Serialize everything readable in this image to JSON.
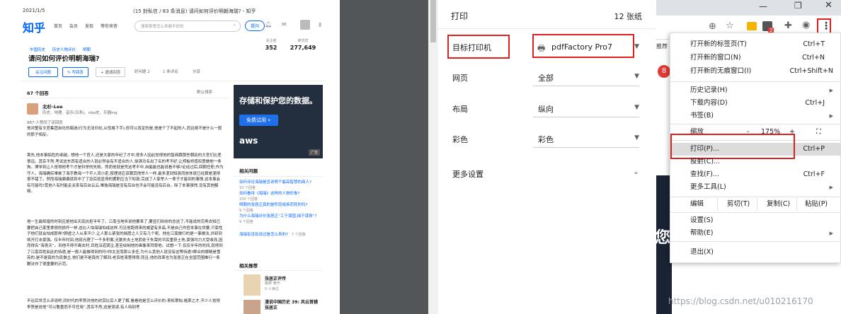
{
  "preview": {
    "date": "2021/1/5",
    "doc_title": "(15 封私信 / 83 条消息) 请问如何评价明朝海瑞? - 知乎",
    "logo": "知乎",
    "nav": [
      "首页",
      "会员",
      "发现",
      "等你来答"
    ],
    "search_placeholder": "搜索那里怎么来都不好的",
    "ask_label": "提问",
    "topics": [
      "中国历史",
      "历史人物评价",
      "明朝"
    ],
    "question": "请问如何评价明朝海瑞?",
    "followers_label": "关注者",
    "followers": "352",
    "views_label": "被浏览",
    "views": "277,649",
    "btn_follow": "关注问题",
    "btn_answer": "写回答",
    "btn_invite": "邀请回答",
    "like": "好问题 2",
    "comments": "1 条评论",
    "share": "分享",
    "answers_count": "67 个回答",
    "sort": "默认排序",
    "author_name": "北杉-Lee",
    "author_desc": "历史、地理、音乐(日系)、nba史、乐器ing",
    "agree": "987 人赞同了该回答",
    "para1": "他对整有文官集团自化的痴迷(行为无法归化,从性格下手),但可以肯定的是,他是个了不起的人,而且绝不是什么一般的那子相反。",
    "para2": "首先,他本事临危的卓越。想他一个官人,还是大家的年纪了才中,很多人因此觉得他的智商跟那些朝廷的大官们比差很远。其实不然,考试这东西有适合的人就必然会有不适合的人,徐渭功名出了名的考不好,让郑板桥感叹愿做他一条狗。博学到让人觉得他考个才是科举的失败。然而他就是凭这考不中,自能能也能说看不够?论经过后,回朝任职,作为守人。海瑞确实难挨了海手教诲一个不入流小吏,按理说应该跟其他举人一样,最多混到知县而放休就已经算是混得很不错了。然而海瑞偏偏就到中了了及后就显得的罢职应当下知县,完成了人家举人一辈子才能到的事情,这本事会有可能吗?其他人有时能走关系有后台云云,唯独海瑞是没有后台也不会可能没有后台。除了本事强悍,没有其他解释。",
    "para3": "他一生最辉煌的时刻应是他出天底抗拒半年了。江南当地听说他要来了,要显们纷纷的念这了,不能说的完再去知已要把自己家里拿很的损坏一样,这比人怕海瑞怕成这样,可见他跑得来的威望有多高,不是自己作官本事在世要,只靠性子他们就会怕成那样?顾虚之人从来不少,让人那么紧张的倘愿之人又有几个呢。他在江南做行的是一事做法,并卸到将开打击豪强。仅半年时间,他就光理了一千多积案,无数失去土地而处于失荣的平民重获土地,豪强均力大受收改,因而得名“海青天”。到他不得不离去时,百姓沿道哭泣,甚至绘制他的画像来拜祭他。试想一下,仅仅半年的时间,就得到了江南百姓如此的待遇,是一般人能做得到的吗?你太至而那么多任,为什么其他人就没有这等待遇?群众的眼睛是雪亮的,是不是真的为民做主,他们是不是真的了解到,老百姓清楚得很,而且,他的改革也为张居正在全国范围推行一条鞭法作了很重要的示范。",
    "para4": "不论后世怎么评说吧,同时代的李贽对他的欣赏比后人更了解,看看他是怎么评价的:青松翠柏,格莱之才,不少人觉得李贽是说他“可以敬重而不可任用”,其实不然,这是误读,有人特别考",
    "ad_title": "存储和保护您的数据。",
    "ad_btn": "免费试用 »",
    "ad_brand": "aws",
    "ad_tag": "广告",
    "related_title": "相关问题",
    "related": [
      {
        "q": "如何评论海瑞是否说明个最高智慧的商人?",
        "n": "10 个回答"
      },
      {
        "q": "如何看待《海瑞》这样的人物形象?",
        "n": "150 个回答"
      },
      {
        "q": "明朝的张居正真的是积怨成疾而死的吗?",
        "n": "9 个回答"
      },
      {
        "q": "为什么海瑞评价张居正“工于谋国,拙于谋身”?",
        "n": "9 个回答"
      },
      {
        "q": "海瑞有没有说过是怎么来的?",
        "n": "7 个回答"
      }
    ],
    "rec_title": "相关推荐",
    "rec1_title": "张居正评传",
    "rec1_sub": "跟野 著作",
    "rec1_cnt": "0 人读过",
    "rec2_title": "漫说中国历史 39: 风云首辅张居正"
  },
  "panel": {
    "title": "打印",
    "sheets": "12 张纸",
    "destination_label": "目标打印机",
    "destination_value": "pdfFactory Pro7",
    "pages_label": "网页",
    "pages_value": "全部",
    "layout_label": "布局",
    "layout_value": "纵向",
    "color_label": "彩色",
    "color_value": "彩色",
    "more_label": "更多设置"
  },
  "browser": {
    "badge_count": "2",
    "notif_count": "8",
    "partial_text": "推荐",
    "big_char": "您"
  },
  "menu": {
    "new_tab": "打开新的标签页(T)",
    "new_tab_sc": "Ctrl+T",
    "new_window": "打开新的窗口(N)",
    "new_window_sc": "Ctrl+N",
    "incognito": "打开新的无痕窗口(I)",
    "incognito_sc": "Ctrl+Shift+N",
    "history": "历史记录(H)",
    "downloads": "下载内容(D)",
    "downloads_sc": "Ctrl+J",
    "bookmarks": "书签(B)",
    "zoom": "缩放",
    "zoom_minus": "-",
    "zoom_value": "175%",
    "zoom_plus": "+",
    "print": "打印(P)...",
    "print_sc": "Ctrl+P",
    "cast": "投射(C)...",
    "find": "查找(F)...",
    "find_sc": "Ctrl+F",
    "more_tools": "更多工具(L)",
    "edit": "编辑",
    "cut": "剪切(T)",
    "copy": "复制(C)",
    "paste": "粘贴(P)",
    "settings": "设置(S)",
    "help": "帮助(E)",
    "exit": "退出(X)"
  },
  "watermark": "https://blog.csdn.net/u010216170",
  "colors": {
    "accent": "#0066ff",
    "highlight_red": "#e02020",
    "chrome_gray": "#5f6368"
  }
}
